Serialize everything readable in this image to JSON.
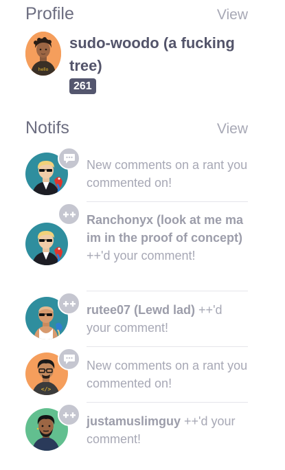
{
  "profile": {
    "title": "Profile",
    "view_label": "View",
    "username": "sudo-woodo (a fucking tree)",
    "score": "261",
    "avatar_shirt_text": "hello",
    "avatar_color": "#f59e5c"
  },
  "notifs": {
    "title": "Notifs",
    "view_label": "View",
    "items": [
      {
        "type": "comment",
        "badge_icon": "comment-bubble-icon",
        "avatar_color": "#2f8e9e",
        "text": "New comments on a rant you commented on!"
      },
      {
        "type": "plusplus",
        "badge_icon": "plus-plus-icon",
        "avatar_color": "#2f8e9e",
        "user": "Ranchonyx (look at me ma im in the proof of concept)",
        "text": " ++'d your comment!"
      },
      {
        "type": "plusplus",
        "badge_icon": "plus-plus-icon",
        "avatar_color": "#2f8e9e",
        "user": "rutee07 (Lewd lad)",
        "text": " ++'d your comment!"
      },
      {
        "type": "comment",
        "badge_icon": "comment-bubble-icon",
        "avatar_color": "#f59e5c",
        "avatar_shirt_text": "</>",
        "text": "New comments on a rant you commented on!"
      },
      {
        "type": "plusplus",
        "badge_icon": "plus-plus-icon",
        "avatar_color": "#62bf8f",
        "user": "justamuslimguy",
        "text": " ++'d your comment!"
      }
    ]
  },
  "colors": {
    "heading": "#6c6d80",
    "muted_text": "#a7a8b5",
    "badge_bg": "#54566e",
    "notif_badge_bg": "#c5c6d0"
  }
}
